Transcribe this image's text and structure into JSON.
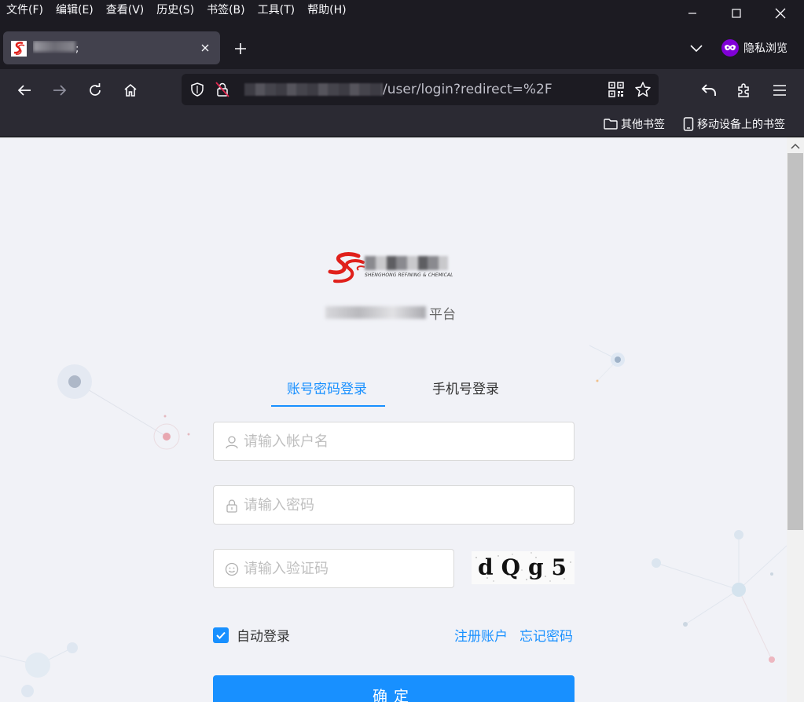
{
  "menu": [
    "文件(F)",
    "编辑(E)",
    "查看(V)",
    "历史(S)",
    "书签(B)",
    "工具(T)",
    "帮助(H)"
  ],
  "tab": {
    "title": ";"
  },
  "private_label": "隐私浏览",
  "url": {
    "path": "/user/login?redirect=%2F"
  },
  "bookmarks": {
    "other": "其他书签",
    "mobile": "移动设备上的书签"
  },
  "page": {
    "logo_caption": "SHENGHONG REFINING & CHEMICAL",
    "subtitle_suffix": "平台",
    "tabs": {
      "account": "账号密码登录",
      "phone": "手机号登录"
    },
    "username_placeholder": "请输入帐户名",
    "password_placeholder": "请输入密码",
    "captcha_placeholder": "请输入验证码",
    "captcha_text": "dQg5",
    "auto_login": "自动登录",
    "register": "注册账户",
    "forgot": "忘记密码",
    "submit": "确定"
  },
  "colors": {
    "accent": "#1890ff",
    "private": "#8000d7"
  }
}
